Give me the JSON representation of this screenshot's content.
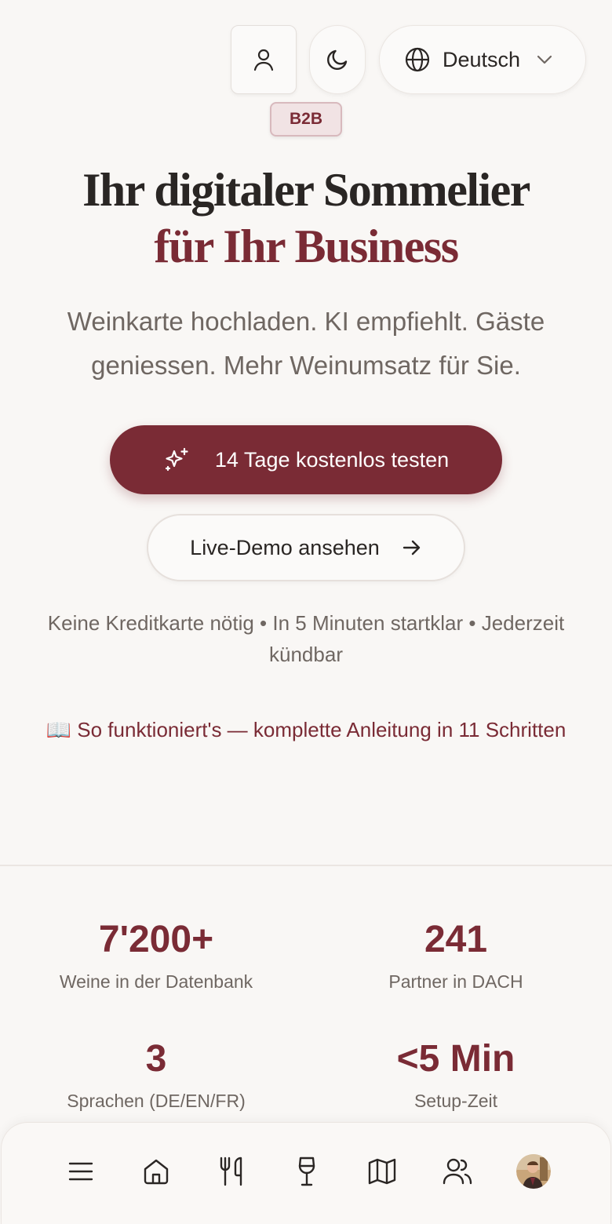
{
  "header": {
    "language_label": "Deutsch",
    "badge": "B2B",
    "icons": {
      "user": "user-icon",
      "theme": "moon-icon",
      "language": "globe-icon",
      "dropdown": "chevron-down-icon"
    }
  },
  "hero": {
    "title_line1": "Ihr digitaler Sommelier",
    "title_line2": "für Ihr Business",
    "subtitle": "Weinkarte hochladen. KI empfiehlt. Gäste geniessen. Mehr Weinumsatz für Sie.",
    "primary_cta": "14 Tage kostenlos testen",
    "secondary_cta": "Live-Demo ansehen",
    "fine_print": "Keine Kreditkarte nötig • In 5 Minuten startklar • Jederzeit kündbar",
    "guide_link": "📖 So funktioniert's — komplette Anleitung in 11 Schritten"
  },
  "stats": [
    {
      "value": "7'200+",
      "label": "Weine in der Datenbank"
    },
    {
      "value": "241",
      "label": "Partner in DACH"
    },
    {
      "value": "3",
      "label": "Sprachen (DE/EN/FR)"
    },
    {
      "value": "<5 Min",
      "label": "Setup-Zeit"
    }
  ],
  "bottom_nav": {
    "items": [
      "menu-icon",
      "home-icon",
      "utensils-icon",
      "wine-glass-icon",
      "map-icon",
      "users-icon",
      "avatar"
    ]
  },
  "colors": {
    "accent": "#7a2b35",
    "background": "#f9f7f5",
    "text": "#2a2624",
    "muted": "#6f6762"
  }
}
